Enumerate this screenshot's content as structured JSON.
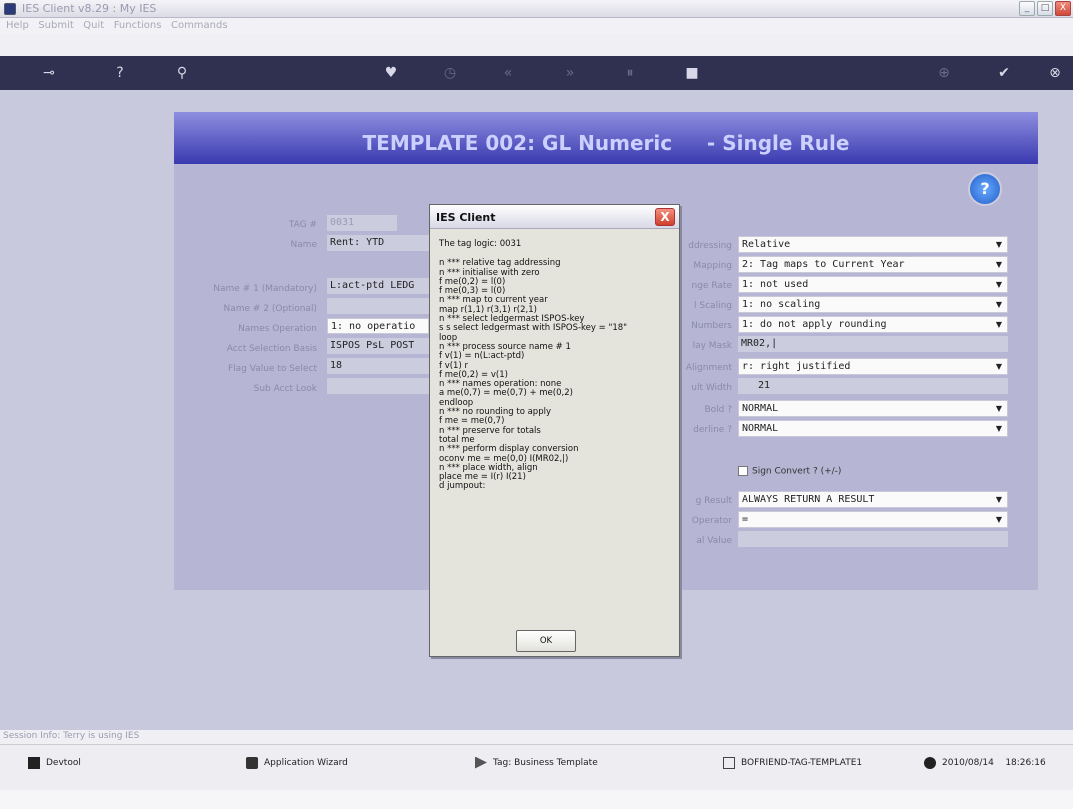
{
  "window": {
    "title": "IES Client v8.29 : My IES",
    "controls": [
      "_",
      "□",
      "X"
    ]
  },
  "menu": [
    "Help",
    "Submit",
    "Quit",
    "Functions",
    "Commands"
  ],
  "toolbar": {
    "icons": [
      "key-icon",
      "help-icon",
      "search-icon",
      "heart-icon",
      "clock-icon",
      "rewind-icon",
      "forward-icon",
      "pause-icon",
      "stop-icon",
      "globe-icon",
      "check-icon",
      "close-icon"
    ],
    "glyphs": [
      "⊸",
      "?",
      "⚲",
      "♥",
      "◷",
      "«",
      "»",
      "⏸",
      "■",
      "⊕",
      "✔",
      "⊗"
    ]
  },
  "template": {
    "title": "TEMPLATE 002: GL Numeric     - Single Rule",
    "help_glyph": "?",
    "left_fields": [
      {
        "label": "TAG #",
        "value": "0031"
      },
      {
        "label": "Name",
        "value": "Rent: YTD"
      },
      {
        "label": "Name # 1 (Mandatory)",
        "value": "L:act-ptd LEDG"
      },
      {
        "label": "Name # 2 (Optional)",
        "value": ""
      },
      {
        "label": "Names Operation",
        "value": "1: no operatio"
      },
      {
        "label": "Acct Selection Basis",
        "value": "ISPOS PsL POST"
      },
      {
        "label": "Flag Value to Select",
        "value": "18"
      },
      {
        "label": "Sub Acct Look",
        "value": ""
      }
    ],
    "right_fields": [
      {
        "label": "ddressing",
        "value": "Relative",
        "dropdown": true
      },
      {
        "label": "Mapping",
        "value": "2: Tag maps to Current Year",
        "dropdown": true
      },
      {
        "label": "nge Rate",
        "value": "1: not used",
        "dropdown": true
      },
      {
        "label": "l Scaling",
        "value": "1: no scaling",
        "dropdown": true
      },
      {
        "label": "Numbers",
        "value": "1: do not apply rounding",
        "dropdown": true
      },
      {
        "label": "lay Mask",
        "value": "MR02,|",
        "dropdown": false
      },
      {
        "label": "Alignment",
        "value": "r: right justified",
        "dropdown": true
      },
      {
        "label": "ult Width",
        "value": "21",
        "dropdown": false
      },
      {
        "label": "Bold ?",
        "value": "NORMAL",
        "dropdown": true
      },
      {
        "label": "derline ?",
        "value": "NORMAL",
        "dropdown": true
      }
    ],
    "sign_convert": "Sign Convert ? (+/-)",
    "lower_right_fields": [
      {
        "label": "g Result",
        "value": "ALWAYS RETURN A RESULT",
        "dropdown": true
      },
      {
        "label": "Operator",
        "value": "=",
        "dropdown": true
      },
      {
        "label": "al Value",
        "value": "",
        "dropdown": false
      }
    ]
  },
  "dialog": {
    "title": "IES Client",
    "close": "X",
    "intro": "The tag logic: 0031",
    "lines": [
      "n *** relative tag addressing",
      "n *** initialise with zero",
      "f me(0,2) = l(0)",
      "f me(0,3) = l(0)",
      "n *** map to current year",
      "map r(1,1) r(3,1) r(2,1)",
      "n *** select ledgermast ISPOS-key",
      "s s select ledgermast with ISPOS-key = \"18\"",
      "loop",
      "n *** process source name # 1",
      "f v(1) = n(L:act-ptd)",
      "f v(1) r",
      "f me(0,2) = v(1)",
      "n *** names operation: none",
      "a me(0,7) = me(0,7) + me(0,2)",
      "endloop",
      "n *** no rounding to apply",
      "f me = me(0,7)",
      "n *** preserve for totals",
      "total me",
      "n *** perform display conversion",
      "oconv me = me(0,0) I(MR02,|)",
      "n *** place width, align",
      "place me = I(r) I(21)",
      "d jumpout:"
    ],
    "ok_label": "OK"
  },
  "status": {
    "session_info": "Session Info: Terry is using IES"
  },
  "taskbar": [
    {
      "label": "Devtool",
      "icon": "devtool-icon"
    },
    {
      "label": "Application Wizard",
      "icon": "wizard-icon"
    },
    {
      "label": "Tag: Business Template",
      "icon": "tag-icon"
    },
    {
      "label": "BOFRIEND-TAG-TEMPLATE1",
      "icon": "template-icon"
    },
    {
      "label": "2010/08/14    18:26:16",
      "icon": "clock-icon"
    }
  ]
}
